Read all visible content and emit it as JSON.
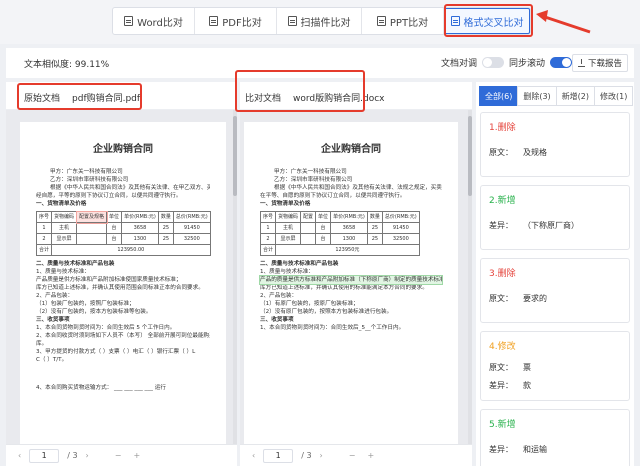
{
  "tabs": [
    {
      "label": "Word比对",
      "width": 82
    },
    {
      "label": "PDF比对",
      "width": 82
    },
    {
      "label": "扫描件比对",
      "width": 85
    },
    {
      "label": "PPT比对",
      "width": 82
    },
    {
      "label": "格式交叉比对",
      "width": 88
    }
  ],
  "active_tab_index": 4,
  "toolbar": {
    "similarity": "文本相似度: 99.11%",
    "doc_align_label": "文档对调",
    "sync_scroll_label": "同步滚动",
    "download_label": "下载报告"
  },
  "original": {
    "label": "原始文档",
    "filename": "pdf购销合同.pdf",
    "page_current": "1",
    "page_total": "/ 3",
    "lines": {
      "title": "企业购销合同",
      "buyer": "甲方：广东关一科技有限公司",
      "seller": "乙方：深圳市率研科技有限公司",
      "intro1": "根据《中华人民共和国合同法》及其他有关法律、在甲乙双方、买卖双方",
      "intro2": "经自愿，平等的原则下协议订立合同，以便共同遵守执行。",
      "sec1": "一、货物清单及价格",
      "table_head": [
        "序号",
        "货物编码",
        "配置及规格",
        "单位",
        "单价(RMB:元)",
        "数量",
        "总价(RMB:元)"
      ],
      "row1": [
        "1",
        "主机",
        "",
        "台",
        "3658",
        "25",
        "91450"
      ],
      "row2": [
        "2",
        "显示屏",
        "",
        "台",
        "1300",
        "25",
        "32500"
      ],
      "total_label": "合计",
      "total_value": "123950.00",
      "sec2": "二、质量与技术标准和产品包装",
      "q1": "1、质量与技术标准：",
      "q2": "产品质量是供方标准和产品附加标准使国家质量技术标准；",
      "q3": "库方已知道上述标准，并确认其使用范围会同标准正本的合同要求。",
      "p1": "2、产品包装：",
      "p2": "（1）包装厂包装的，按照厂包装标准；",
      "p3": "（2）没有厂包装的，按本方包装标准等包装。",
      "sec3": "三、收货事项",
      "d1": "1、本合同货物到货时间为：合同生效后      5       个工作日内。",
      "d2": "2、本合同收货时须到场如下人员不（本写）        全部前开展可到位最能购买",
      "d3": "库。",
      "d4": "3、甲方提货的付款方式（      ）支票（      ）电汇（      ）银行汇票（      ）L",
      "d5": "C（      ）T/T。",
      "last": "4、本合同购买货物运输方式：  ___  ___  ___  ___  运行"
    }
  },
  "compare": {
    "label": "比对文档",
    "filename": "word版购销合同.docx",
    "page_current": "1",
    "page_total": "/ 3",
    "lines": {
      "title": "企业购销合同",
      "buyer": "甲方：广东关一科技有限公司",
      "seller": "乙方：深圳市率研科技有限公司",
      "intro1": "根据《中华人民共和国合同法》及其他有关法律、法规之规定，买卖双方",
      "intro2": "在平等、自愿的原则下协议订立合同，以便共同遵守执行。",
      "sec1": "一、货物清单及价格",
      "table_head": [
        "序号",
        "货物编码",
        "配置",
        "单位",
        "单价(RMB:元)",
        "数量",
        "总价(RMB:元)"
      ],
      "row1": [
        "1",
        "主机",
        "",
        "台",
        "3658",
        "25",
        "91450"
      ],
      "row2": [
        "2",
        "显示屏",
        "",
        "台",
        "1300",
        "25",
        "32500"
      ],
      "total_label": "合计",
      "total_value": "123950元",
      "sec2": "二、质量与技术标准和产品包装",
      "q1": "1、质量与技术标准：",
      "q2": "产品的质量是供方标准和产品附加标准（下称原厂商）制定的质量技术标准；",
      "q3": "库方已知道上述标准，并确认其使用的标准能满足本方合同的要求。",
      "p1": "2、产品包装：",
      "p2": "（1）有原厂包装的，按原厂包装标准；",
      "p3": "（2）没有原厂包装的，按照本方包装标准进行包装。",
      "sec3": "三、收货事项",
      "d1": "1、本合同货物到货时间为：合同生效后_5__个工作日内。",
      "d2": ""
    }
  },
  "diff": {
    "filters": [
      {
        "label": "全部(6)"
      },
      {
        "label": "删除(3)"
      },
      {
        "label": "新增(2)"
      },
      {
        "label": "修改(1)"
      }
    ],
    "items": [
      {
        "title": "1.删除",
        "type": "del",
        "key": "原文：",
        "value": "及规格"
      },
      {
        "title": "2.新增",
        "type": "add",
        "key": "差异：",
        "value": "（下称原厂商）"
      },
      {
        "title": "3.删除",
        "type": "del",
        "key": "原文：",
        "value": "要求的"
      },
      {
        "title": "4.修改",
        "type": "mod",
        "key": "原文：",
        "value": "票",
        "key2": "差异：",
        "value2": "款"
      },
      {
        "title": "5.新增",
        "type": "add",
        "key": "差异：",
        "value": "和运输"
      }
    ]
  },
  "colors": {
    "accent": "#2f6bd8",
    "delete": "#e5443c",
    "add": "#27b14b",
    "modify": "#f0a020",
    "highlight_box": "#e53b2c"
  }
}
